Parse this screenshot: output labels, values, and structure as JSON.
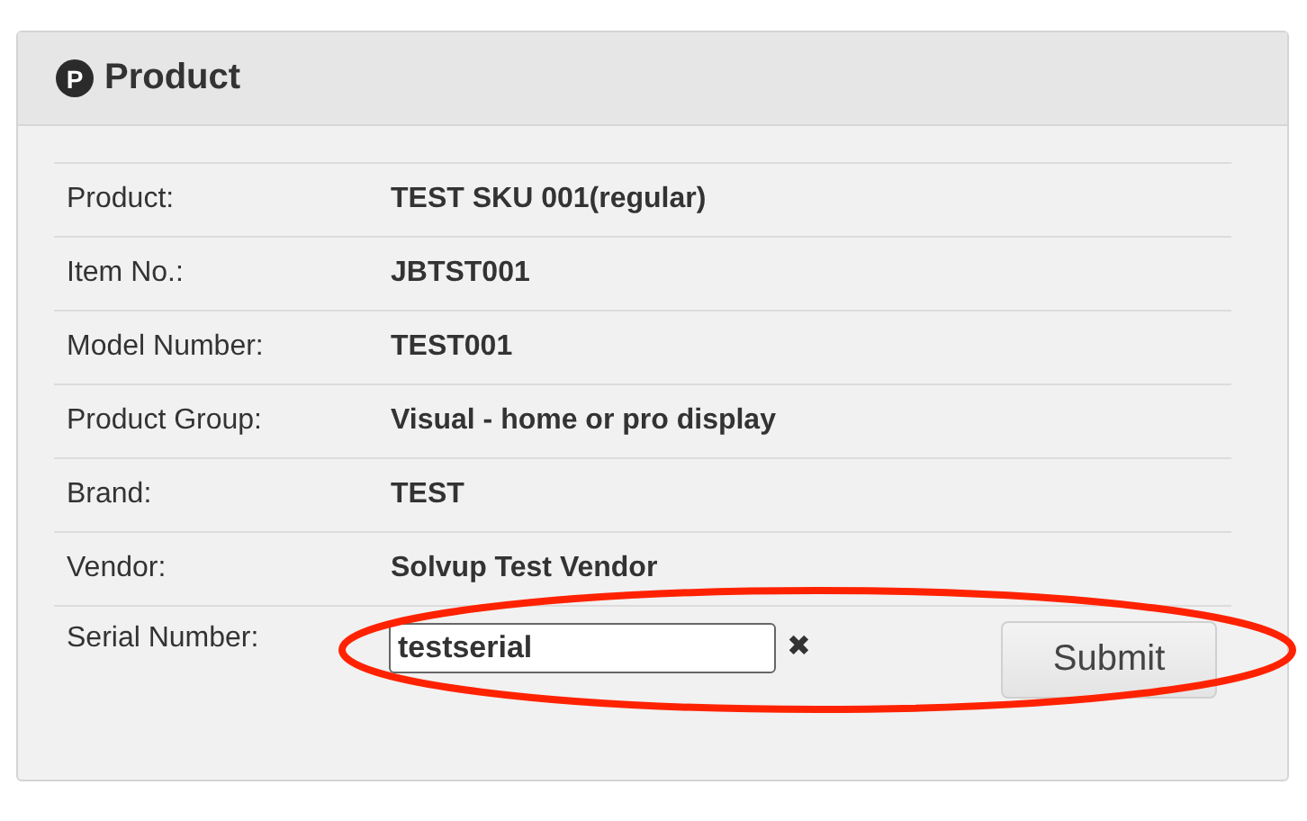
{
  "panel": {
    "icon_letter": "P",
    "title": "Product"
  },
  "rows": [
    {
      "label": "Product:",
      "value": "TEST SKU 001(regular)"
    },
    {
      "label": "Item No.:",
      "value": "JBTST001"
    },
    {
      "label": "Model Number:",
      "value": "TEST001"
    },
    {
      "label": "Product Group:",
      "value": "Visual - home or pro display"
    },
    {
      "label": "Brand:",
      "value": "TEST"
    },
    {
      "label": "Vendor:",
      "value": "Solvup Test Vendor"
    }
  ],
  "serial": {
    "label": "Serial Number:",
    "value": "testserial",
    "clear": "✖",
    "button": "Submit"
  },
  "annotation": {
    "kind": "ellipse",
    "color": "#ff2200"
  }
}
